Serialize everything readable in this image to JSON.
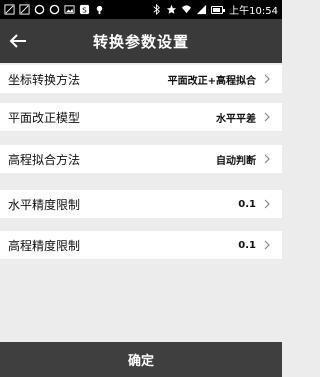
{
  "status_bar": {
    "time": "上午10:54",
    "icons": [
      "notification-icon",
      "photo-icon",
      "sync-icon",
      "sync-icon",
      "image-icon",
      "s-icon",
      "location-icon",
      "bluetooth-icon",
      "star-icon",
      "wifi-icon",
      "signal-icon",
      "battery-icon"
    ]
  },
  "header": {
    "title": "转换参数设置",
    "back_icon": "arrow-left-icon"
  },
  "settings": [
    {
      "label": "坐标转换方法",
      "value": "平面改正+高程拟合"
    },
    {
      "label": "平面改正模型",
      "value": "水平平差"
    },
    {
      "label": "高程拟合方法",
      "value": "自动判断"
    },
    {
      "label": "水平精度限制",
      "value": "0.1"
    },
    {
      "label": "高程精度限制",
      "value": "0.1"
    }
  ],
  "footer": {
    "confirm_label": "确定"
  },
  "colors": {
    "header_bg": "#3a3a3a",
    "footer_bg": "#3f3f3f",
    "page_bg": "#ececec",
    "row_bg": "#ffffff"
  }
}
